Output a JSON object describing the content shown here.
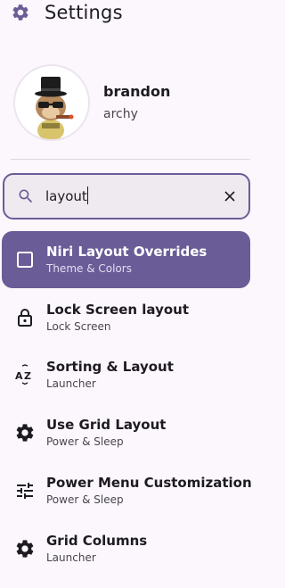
{
  "header": {
    "title": "Settings",
    "icon": "gear-icon"
  },
  "profile": {
    "name": "brandon",
    "subtitle": "archy"
  },
  "search": {
    "value": "layout",
    "placeholder": ""
  },
  "results": [
    {
      "label": "Niri Layout Overrides",
      "sub": "Theme & Colors",
      "icon": "checkbox-icon",
      "active": true
    },
    {
      "label": "Lock Screen layout",
      "sub": "Lock Screen",
      "icon": "lock-icon",
      "active": false
    },
    {
      "label": "Sorting & Layout",
      "sub": "Launcher",
      "icon": "sort-az-icon",
      "active": false
    },
    {
      "label": "Use Grid Layout",
      "sub": "Power & Sleep",
      "icon": "gear-icon",
      "active": false
    },
    {
      "label": "Power Menu Customization",
      "sub": "Power & Sleep",
      "icon": "tune-icon",
      "active": false
    },
    {
      "label": "Grid Columns",
      "sub": "Launcher",
      "icon": "gear-icon",
      "active": false
    }
  ],
  "colors": {
    "accent": "#6a5c97",
    "background": "#fcf7fd",
    "text": "#1d1b20",
    "subtext": "#49454f"
  }
}
